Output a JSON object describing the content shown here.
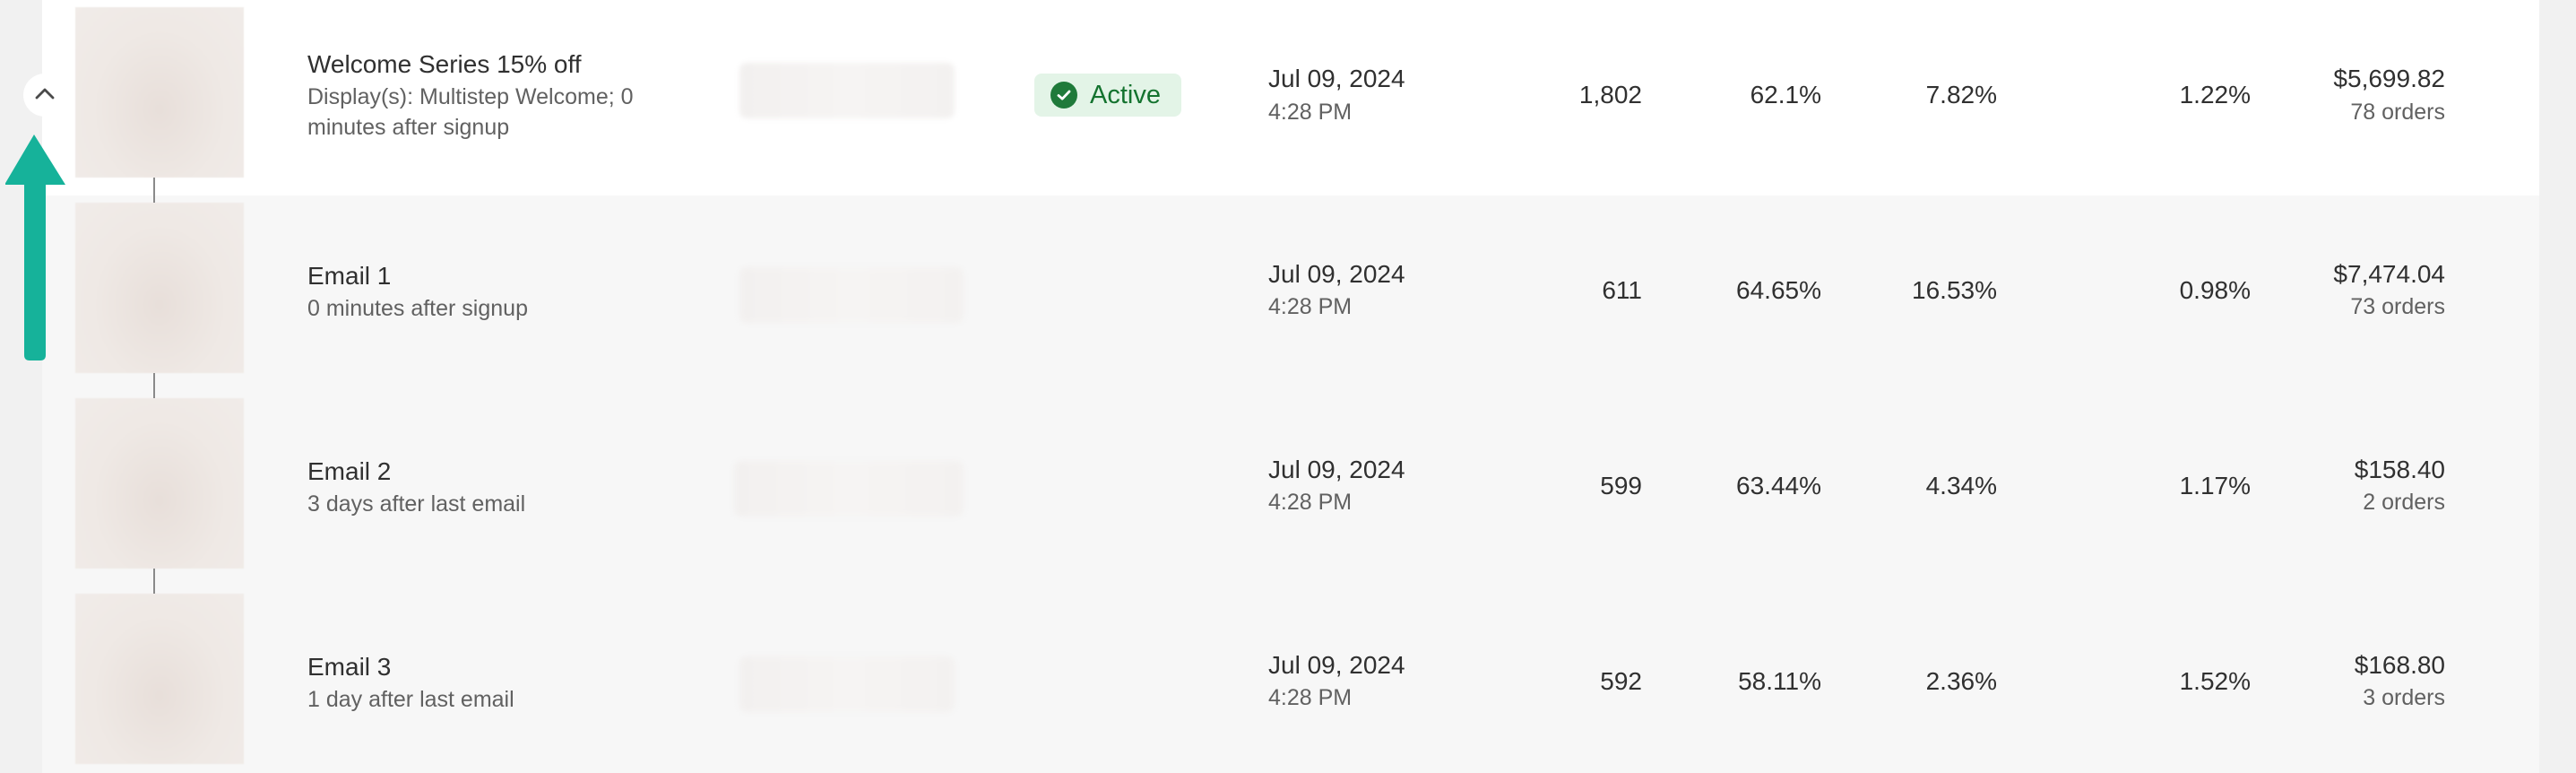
{
  "controls": {
    "collapse_icon": "chevron-up-icon",
    "annotation": "arrow-up-icon",
    "annotation_color": "#16b29a"
  },
  "colors": {
    "active_bg": "#e3f4e7",
    "active_text": "#14732f"
  },
  "rows": [
    {
      "title": "Welcome Series 15% off",
      "desc_line1": "Display(s): Multistep Welcome; 0",
      "desc_line2": "minutes after signup",
      "status": "Active",
      "date": "Jul 09, 2024",
      "time": "4:28 PM",
      "sends": "1,802",
      "open_rate": "62.1%",
      "click_rate": "7.82%",
      "conversion_rate": "1.22%",
      "revenue": "$5,699.82",
      "orders": "78 orders"
    },
    {
      "title": "Email 1",
      "desc_line1": "0 minutes after signup",
      "date": "Jul 09, 2024",
      "time": "4:28 PM",
      "sends": "611",
      "open_rate": "64.65%",
      "click_rate": "16.53%",
      "conversion_rate": "0.98%",
      "revenue": "$7,474.04",
      "orders": "73 orders"
    },
    {
      "title": "Email 2",
      "desc_line1": "3 days after last email",
      "date": "Jul 09, 2024",
      "time": "4:28 PM",
      "sends": "599",
      "open_rate": "63.44%",
      "click_rate": "4.34%",
      "conversion_rate": "1.17%",
      "revenue": "$158.40",
      "orders": "2 orders"
    },
    {
      "title": "Email 3",
      "desc_line1": "1 day after last email",
      "date": "Jul 09, 2024",
      "time": "4:28 PM",
      "sends": "592",
      "open_rate": "58.11%",
      "click_rate": "2.36%",
      "conversion_rate": "1.52%",
      "revenue": "$168.80",
      "orders": "3 orders"
    }
  ]
}
